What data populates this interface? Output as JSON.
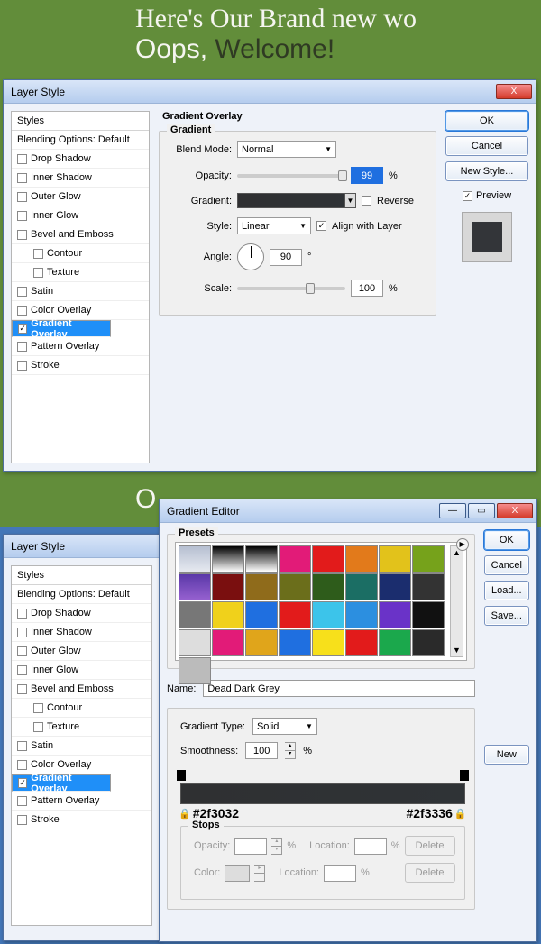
{
  "hero": {
    "line1": "Here's Our Brand new wo",
    "line2a": "Oops, ",
    "line2b": "Welcome!"
  },
  "band2": "O",
  "window_ls_title": "Layer Style",
  "close_x": "X",
  "min_glyph": "—",
  "max_glyph": "▭",
  "styles_header": "Styles",
  "styles_blending": "Blending Options: Default",
  "style_items": [
    {
      "label": "Drop Shadow",
      "checked": false,
      "indent": false
    },
    {
      "label": "Inner Shadow",
      "checked": false,
      "indent": false
    },
    {
      "label": "Outer Glow",
      "checked": false,
      "indent": false
    },
    {
      "label": "Inner Glow",
      "checked": false,
      "indent": false
    },
    {
      "label": "Bevel and Emboss",
      "checked": false,
      "indent": false
    },
    {
      "label": "Contour",
      "checked": false,
      "indent": true
    },
    {
      "label": "Texture",
      "checked": false,
      "indent": true
    },
    {
      "label": "Satin",
      "checked": false,
      "indent": false
    },
    {
      "label": "Color Overlay",
      "checked": false,
      "indent": false
    },
    {
      "label": "Gradient Overlay",
      "checked": true,
      "indent": false,
      "selected": true
    },
    {
      "label": "Pattern Overlay",
      "checked": false,
      "indent": false
    },
    {
      "label": "Stroke",
      "checked": false,
      "indent": false
    }
  ],
  "grad_overlay": {
    "section_title": "Gradient Overlay",
    "group_title": "Gradient",
    "blend_mode_label": "Blend Mode:",
    "blend_mode_value": "Normal",
    "opacity_label": "Opacity:",
    "opacity_value": "99",
    "percent": "%",
    "gradient_label": "Gradient:",
    "reverse_label": "Reverse",
    "style_label": "Style:",
    "style_value": "Linear",
    "align_label": "Align with Layer",
    "angle_label": "Angle:",
    "angle_value": "90",
    "degree": "°",
    "scale_label": "Scale:",
    "scale_value": "100"
  },
  "right_buttons": {
    "ok": "OK",
    "cancel": "Cancel",
    "new_style": "New Style...",
    "preview": "Preview"
  },
  "gradient_editor": {
    "title": "Gradient Editor",
    "presets_label": "Presets",
    "preset_colors": [
      "linear-gradient(#b6bfd1,#e6e9f0)",
      "linear-gradient(#000,#fff)",
      "linear-gradient(#000,transparent)",
      "#e21b78",
      "#e21b1b",
      "#e27a1b",
      "#e2c21b",
      "#76a21b",
      "linear-gradient(#5a38a8,#9560cf)",
      "#7a0f0f",
      "#8f6b1b",
      "#6b6e1b",
      "#2e5c1b",
      "#1b6e64",
      "#1b2d6e",
      "#333",
      "#777",
      "#f0d11b",
      "#1f6fe0",
      "#e21b1b",
      "#3cc4ea",
      "#2c8fe0",
      "#6a33c8",
      "#111",
      "#ddd",
      "#e21b78",
      "#e0a51b",
      "#1f6fe0",
      "#f7e01b",
      "#e21b1b",
      "#1ba84c",
      "#2a2a2a",
      "#bbb"
    ],
    "name_label": "Name:",
    "name_value": "Dead Dark Grey",
    "new": "New",
    "type_label": "Gradient Type:",
    "type_value": "Solid",
    "smooth_label": "Smoothness:",
    "smooth_value": "100",
    "stops_label": "Stops",
    "stop_left": "#2f3032",
    "stop_right": "#2f3336",
    "opacity_label": "Opacity:",
    "location_label": "Location:",
    "color_label": "Color:",
    "delete": "Delete",
    "ok": "OK",
    "cancel": "Cancel",
    "load": "Load...",
    "save": "Save..."
  }
}
